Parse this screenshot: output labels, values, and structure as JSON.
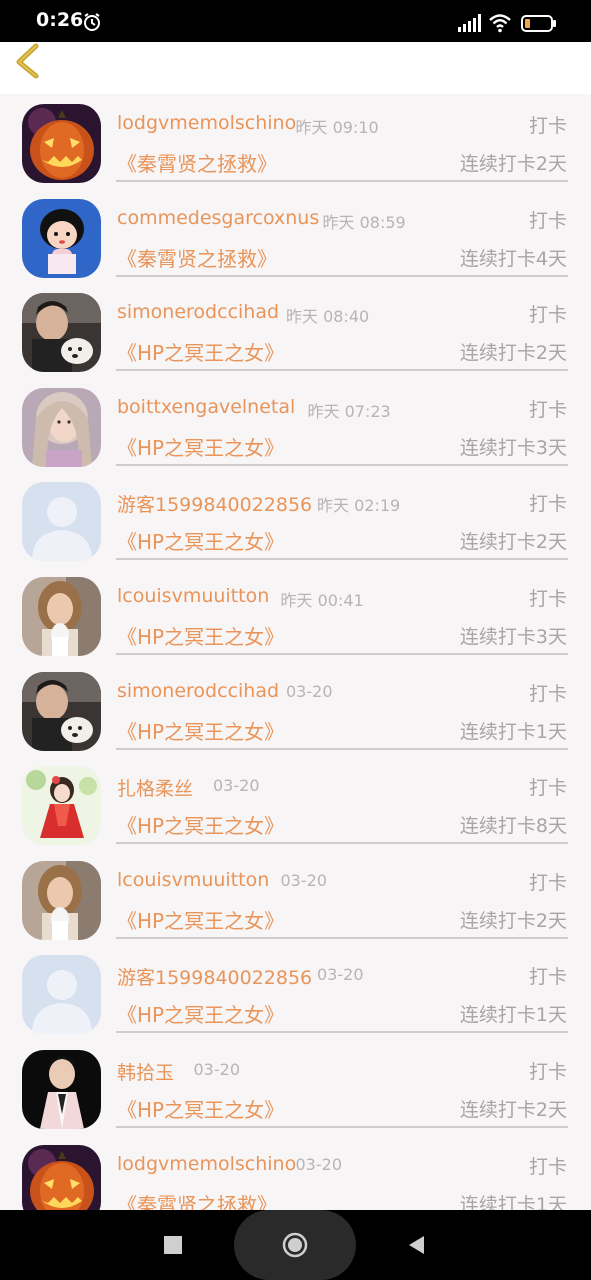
{
  "status_bar": {
    "time": "0:26",
    "battery_color": "#f0a64e",
    "icons": [
      "alarm-icon",
      "signal-icon",
      "wifi-icon",
      "battery-icon"
    ]
  },
  "header": {
    "back_icon": "chevron-left-icon",
    "back_color": "#c9a227"
  },
  "colors": {
    "accent": "#e9955a",
    "muted": "#aaa4a4",
    "background": "#f7f5f6"
  },
  "rows": [
    {
      "user": "lodgvmemolschino",
      "time": "昨天 09:10",
      "action": "打卡",
      "book": "《秦霄贤之拯救》",
      "streak": "连续打卡2天",
      "avatar": "pumpkin"
    },
    {
      "user": "commedesgarcoxnus",
      "time": "昨天 08:59",
      "action": "打卡",
      "book": "《秦霄贤之拯救》",
      "streak": "连续打卡4天",
      "avatar": "cartoon-girl"
    },
    {
      "user": "simonerodccihad",
      "time": "昨天 08:40",
      "action": "打卡",
      "book": "《HP之冥王之女》",
      "streak": "连续打卡2天",
      "avatar": "man-dog"
    },
    {
      "user": "boittxengavelnetal",
      "time": "昨天 07:23",
      "action": "打卡",
      "book": "《HP之冥王之女》",
      "streak": "连续打卡3天",
      "avatar": "girl-portrait"
    },
    {
      "user": "游客1599840022856",
      "time": "昨天 02:19",
      "action": "打卡",
      "book": "《HP之冥王之女》",
      "streak": "连续打卡2天",
      "avatar": "default"
    },
    {
      "user": "lcouisvmuuitton",
      "time": "昨天 00:41",
      "action": "打卡",
      "book": "《HP之冥王之女》",
      "streak": "连续打卡3天",
      "avatar": "woman-cup"
    },
    {
      "user": "simonerodccihad",
      "time": "03-20",
      "action": "打卡",
      "book": "《HP之冥王之女》",
      "streak": "连续打卡1天",
      "avatar": "man-dog"
    },
    {
      "user": "扎格柔丝",
      "time": "03-20",
      "action": "打卡",
      "book": "《HP之冥王之女》",
      "streak": "连续打卡8天",
      "avatar": "anime-girl"
    },
    {
      "user": "lcouisvmuuitton",
      "time": "03-20",
      "action": "打卡",
      "book": "《HP之冥王之女》",
      "streak": "连续打卡2天",
      "avatar": "woman-cup"
    },
    {
      "user": "游客1599840022856",
      "time": "03-20",
      "action": "打卡",
      "book": "《HP之冥王之女》",
      "streak": "连续打卡1天",
      "avatar": "default"
    },
    {
      "user": "韩拾玉",
      "time": "03-20",
      "action": "打卡",
      "book": "《HP之冥王之女》",
      "streak": "连续打卡2天",
      "avatar": "man-suit"
    },
    {
      "user": "lodgvmemolschino",
      "time": "03-20",
      "action": "打卡",
      "book": "《秦霄贤之拯救》",
      "streak": "连续打卡1天",
      "avatar": "pumpkin"
    }
  ],
  "nav_bar": {
    "icons": [
      "recent-apps-icon",
      "home-icon",
      "back-triangle-icon"
    ]
  }
}
